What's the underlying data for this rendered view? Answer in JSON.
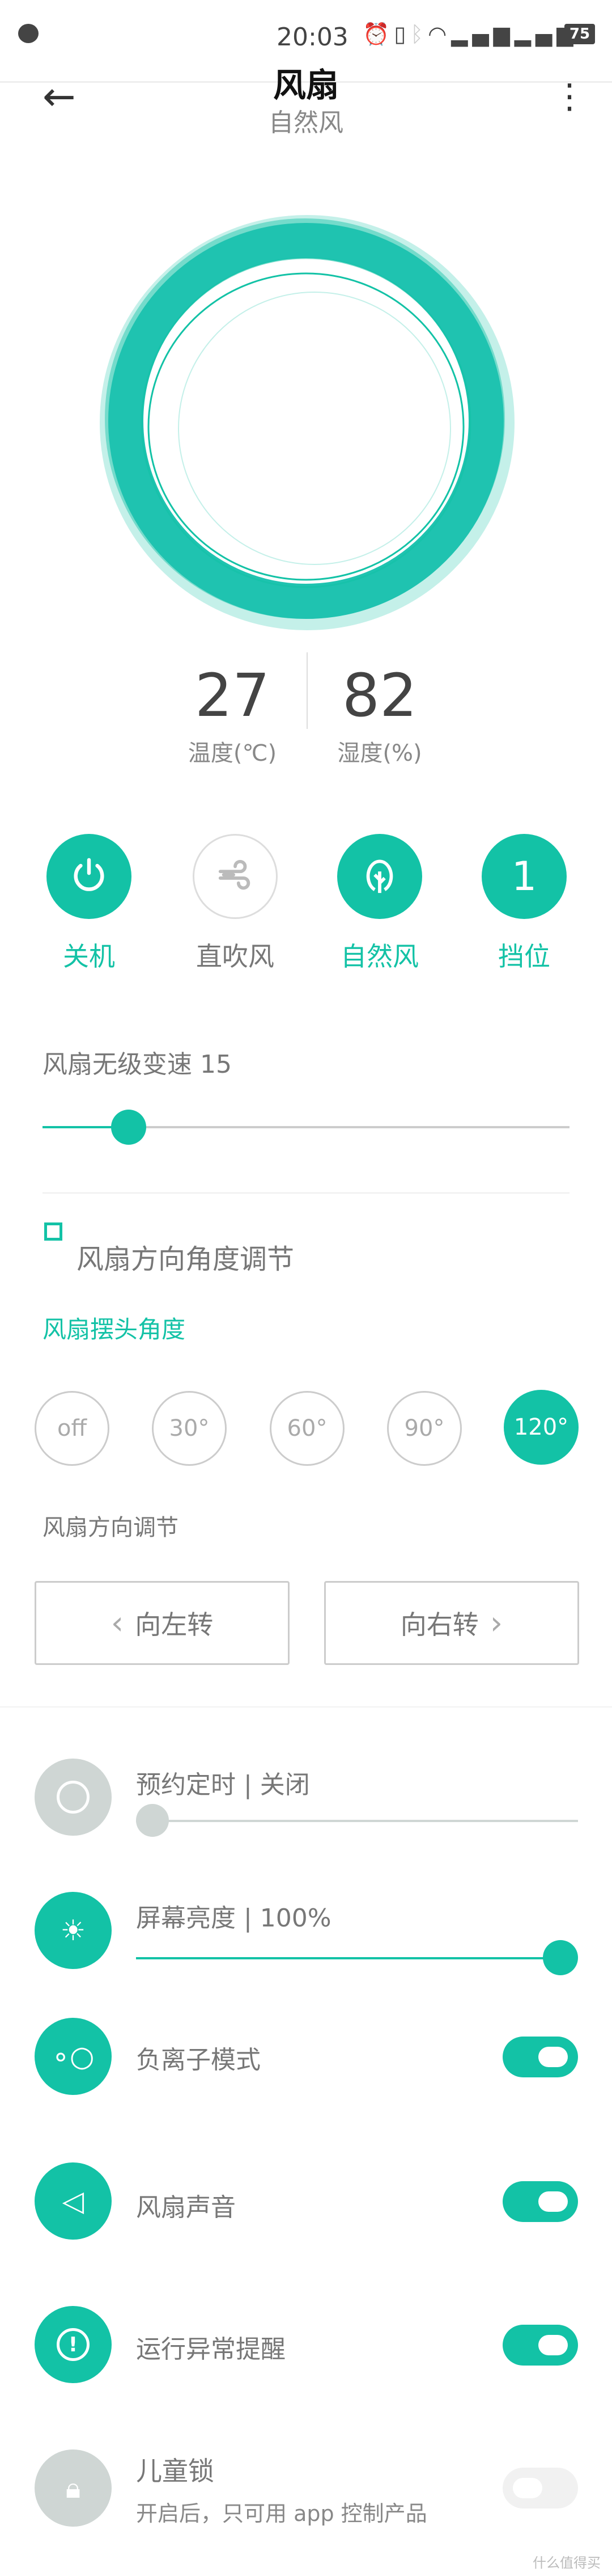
{
  "status_bar": {
    "time": "20:03",
    "battery": "75",
    "icons": [
      "chat-bubble",
      "alarm",
      "vibrate",
      "bluetooth",
      "wifi",
      "signal-1",
      "signal-2"
    ]
  },
  "header": {
    "title": "风扇",
    "subtitle": "自然风"
  },
  "stats": {
    "temperature": {
      "value": "27",
      "label": "温度(℃)"
    },
    "humidity": {
      "value": "82",
      "label": "湿度(%)"
    }
  },
  "modes": [
    {
      "label": "关机",
      "icon": "power-icon",
      "active": true
    },
    {
      "label": "直吹风",
      "icon": "wind-icon",
      "active": false
    },
    {
      "label": "自然风",
      "icon": "leaf-icon",
      "active": true
    },
    {
      "label": "挡位",
      "icon": "1",
      "active": true
    }
  ],
  "speed": {
    "label": "风扇无级变速 15",
    "value": 15
  },
  "direction": {
    "section_title": "风扇方向角度调节",
    "swing_title": "风扇摆头角度",
    "angles": [
      "off",
      "30°",
      "60°",
      "90°",
      "120°"
    ],
    "selected": "120°",
    "adjust_title": "风扇方向调节",
    "left": "向左转",
    "right": "向右转"
  },
  "settings": {
    "timer": {
      "label": "预约定时 | 关闭",
      "value": 0
    },
    "brightness": {
      "label": "屏幕亮度 | 100%",
      "value": 100
    },
    "ion": {
      "label": "负离子模式",
      "on": true
    },
    "sound": {
      "label": "风扇声音",
      "on": true
    },
    "alert": {
      "label": "运行异常提醒",
      "on": true
    },
    "child_lock": {
      "label": "儿童锁",
      "sub": "开启后，只可用 app 控制产品",
      "on": false
    }
  },
  "watermark": "什么值得买",
  "colors": {
    "accent": "#13c2a6",
    "inactive": "#cfd6d4"
  }
}
